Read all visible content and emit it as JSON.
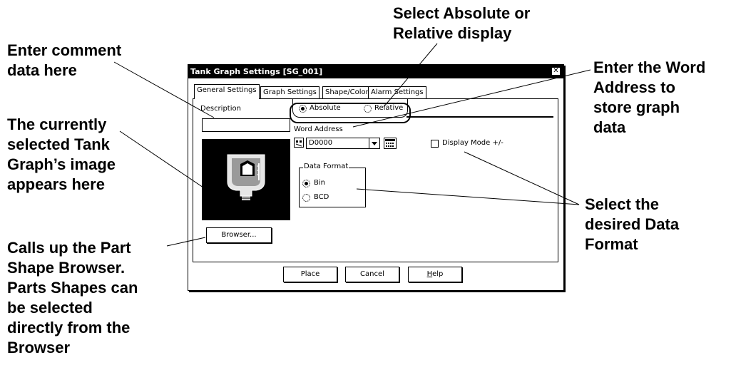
{
  "callouts": {
    "comment": "Enter comment\ndata here",
    "image": "The currently\nselected Tank\nGraph’s image\nappears here",
    "browser": "Calls up the Part\nShape Browser.\nParts Shapes can\nbe selected\ndirectly from the\nBrowser",
    "display": "Select Absolute or\nRelative display",
    "word_address": "Enter the Word\nAddress to\nstore graph\ndata",
    "data_format": "Select the\ndesired Data\nFormat"
  },
  "dialog": {
    "title": "Tank Graph Settings [SG_001]",
    "close_glyph": "✕",
    "tabs": [
      {
        "label": "General Settings"
      },
      {
        "label": "Graph Settings"
      },
      {
        "label": "Shape/Color"
      },
      {
        "label": "Alarm Settings"
      }
    ],
    "description_label": "Description",
    "description_value": "",
    "display_options": [
      "Absolute",
      "Relative"
    ],
    "display_selected": "Absolute",
    "word_address_label": "Word Address",
    "word_address_value": "D0000",
    "display_mode_label": "Display Mode +/-",
    "data_format_label": "Data Format",
    "data_format_options": [
      "Bin",
      "BCD"
    ],
    "data_format_selected": "Bin",
    "browser_button": "Browser...",
    "buttons": {
      "place": "Place",
      "cancel": "Cancel",
      "help_prefix": "",
      "help_underlined": "H",
      "help_rest": "elp"
    }
  }
}
